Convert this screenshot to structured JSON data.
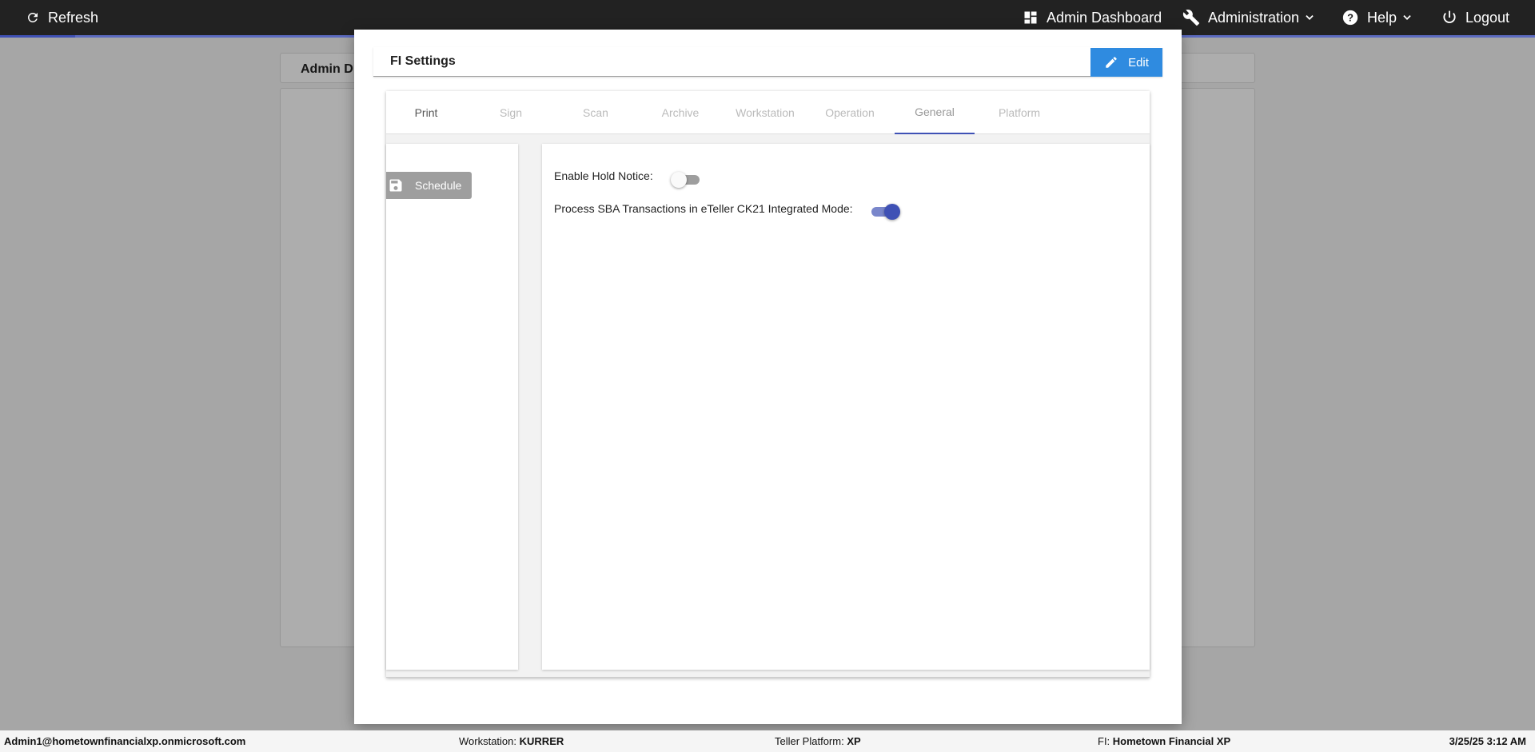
{
  "topbar": {
    "refresh_label": "Refresh",
    "admin_dashboard_label": "Admin Dashboard",
    "administration_label": "Administration",
    "help_label": "Help",
    "logout_label": "Logout"
  },
  "background": {
    "card_title": "Admin D"
  },
  "modal": {
    "title": "FI Settings",
    "edit_label": "Edit",
    "tabs": [
      {
        "label": "Print"
      },
      {
        "label": "Sign"
      },
      {
        "label": "Scan"
      },
      {
        "label": "Archive"
      },
      {
        "label": "Workstation"
      },
      {
        "label": "Operation"
      },
      {
        "label": "General"
      },
      {
        "label": "Platform"
      }
    ],
    "active_tab": "General",
    "schedule_label": "Schedule",
    "settings": [
      {
        "label": "Enable Hold Notice:",
        "enabled": false
      },
      {
        "label": "Process SBA Transactions in eTeller CK21 Integrated Mode:",
        "enabled": true
      }
    ]
  },
  "statusbar": {
    "user": "Admin1@hometownfinancialxp.onmicrosoft.com",
    "workstation_label": "Workstation:",
    "workstation_value": "KURRER",
    "platform_label": "Teller Platform:",
    "platform_value": "XP",
    "fi_label": "FI:",
    "fi_value": "Hometown Financial XP",
    "datetime": "3/25/25 3:12 AM"
  },
  "colors": {
    "accent": "#3f51b5",
    "edit_button": "#2f8be0",
    "topbar": "#222222"
  }
}
